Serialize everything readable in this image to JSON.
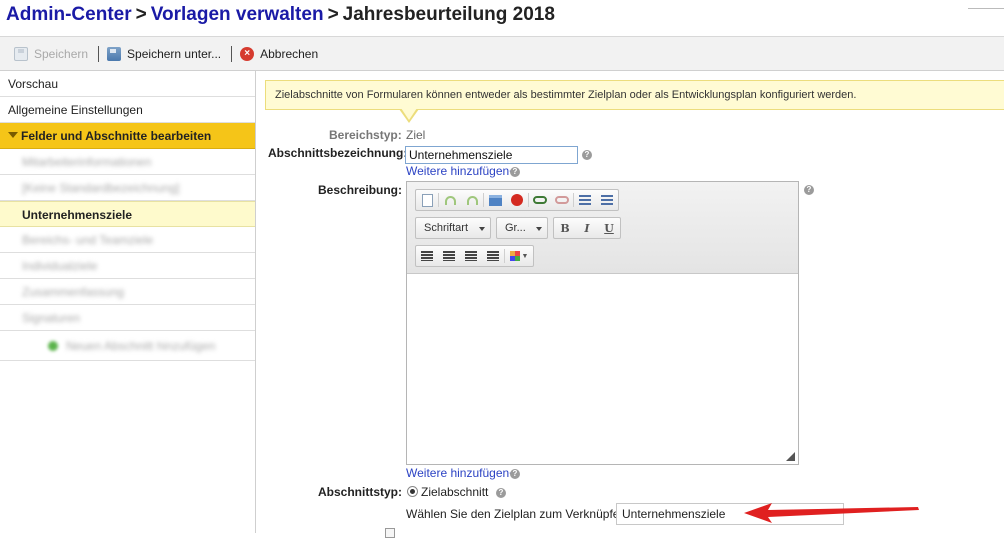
{
  "breadcrumb": {
    "items": [
      "Admin-Center",
      "Vorlagen verwalten",
      "Jahresbeurteilung 2018"
    ],
    "separator": ">"
  },
  "toolbar": {
    "save_label": "Speichern",
    "save_as_label": "Speichern unter...",
    "cancel_label": "Abbrechen"
  },
  "sidebar": {
    "items": [
      {
        "label": "Vorschau"
      },
      {
        "label": "Allgemeine Einstellungen"
      },
      {
        "label": "Felder und Abschnitte bearbeiten"
      }
    ],
    "subitems": [
      {
        "label": "Mitarbeiterinformationen"
      },
      {
        "label": "[Keine Standardbezeichnung]"
      },
      {
        "label": "Unternehmensziele"
      },
      {
        "label": "Bereichs- und Teamziele"
      },
      {
        "label": "Individualziele"
      },
      {
        "label": "Zusammenfassung"
      },
      {
        "label": "Signaturen"
      }
    ],
    "add_label": "Neuen Abschnitt hinzufügen"
  },
  "info": {
    "text": "Zielabschnitte von Formularen können entweder als bestimmter Zielplan oder als Entwicklungsplan konfiguriert werden."
  },
  "form": {
    "bereichstyp_label": "Bereichstyp:",
    "bereichstyp_value": "Ziel",
    "abschnittsbezeichnung_label": "Abschnittsbezeichnung:",
    "abschnittsbezeichnung_value": "Unternehmensziele",
    "weitere_label": "Weitere hinzufügen+",
    "beschreibung_label": "Beschreibung:",
    "abschnittstyp_label": "Abschnittstyp:",
    "abschnittstyp_option": "Zielabschnitt",
    "zielplan_label": "Wählen Sie den Zielplan zum Verknüpfen",
    "zielplan_value": "Unternehmensziele"
  },
  "editor": {
    "font_combo": "Schriftart",
    "size_combo": "Gr...",
    "bold": "B",
    "italic": "I",
    "underline": "U"
  },
  "colors": {
    "link": "#1a1aa6",
    "active_sidebar": "#f5c518",
    "selected_sidebar": "#fefacc",
    "info_bg": "#fffbd3",
    "annotation_arrow": "#e02020"
  }
}
